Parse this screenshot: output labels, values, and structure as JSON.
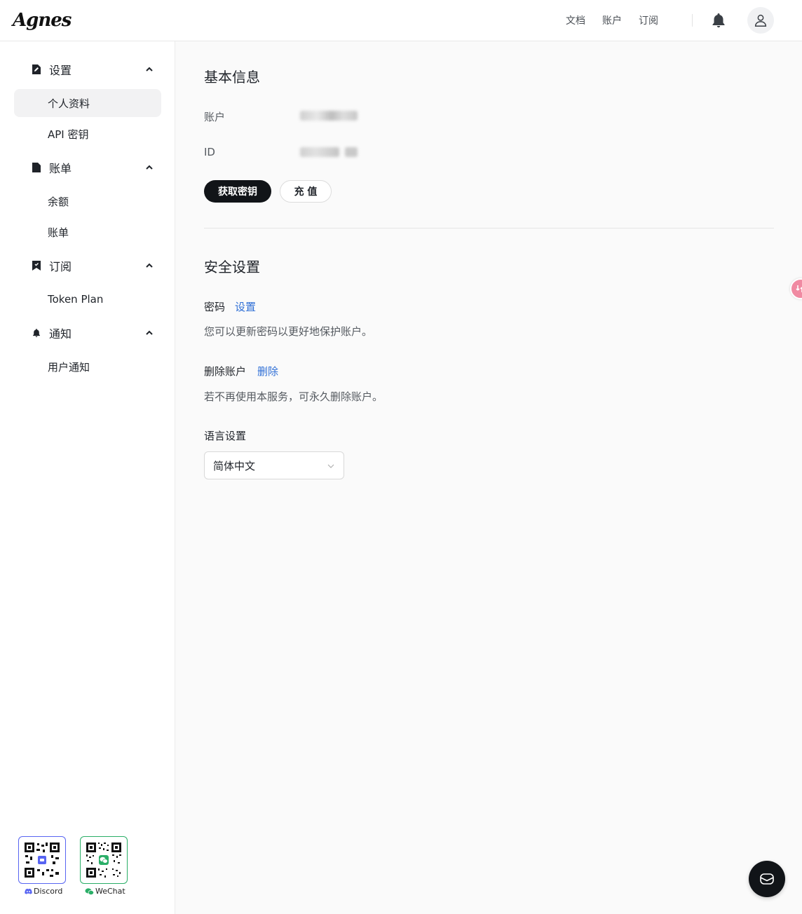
{
  "header": {
    "logo_text": "Agnes",
    "nav": [
      "文档",
      "账户",
      "订阅"
    ]
  },
  "sidebar": {
    "groups": [
      {
        "label": "设置",
        "icon": "document-icon",
        "items": [
          "个人资料",
          "API 密钥"
        ]
      },
      {
        "label": "账单",
        "icon": "file-icon",
        "items": [
          "余额",
          "账单"
        ]
      },
      {
        "label": "订阅",
        "icon": "bookmark-icon",
        "items": [
          "Token Plan"
        ]
      },
      {
        "label": "通知",
        "icon": "bell-icon",
        "items": [
          "用户通知"
        ]
      }
    ],
    "active_item": "个人资料",
    "qr": [
      {
        "label": "Discord",
        "color": "#5865f2"
      },
      {
        "label": "WeChat",
        "color": "#2aae67"
      }
    ]
  },
  "main": {
    "basic": {
      "title": "基本信息",
      "account_label": "账户",
      "id_label": "ID",
      "get_key_button": "获取密钥",
      "recharge_button": "充 值"
    },
    "security": {
      "title": "安全设置",
      "password_label": "密码",
      "password_link": "设置",
      "password_desc": "您可以更新密码以更好地保护账户。",
      "delete_label": "删除账户",
      "delete_link": "删除",
      "delete_desc": "若不再使用本服务，可永久删除账户。",
      "language_label": "语言设置",
      "language_value": "简体中文"
    }
  },
  "colors": {
    "accent": "#2f6fd6",
    "primary_button": "#111418"
  }
}
